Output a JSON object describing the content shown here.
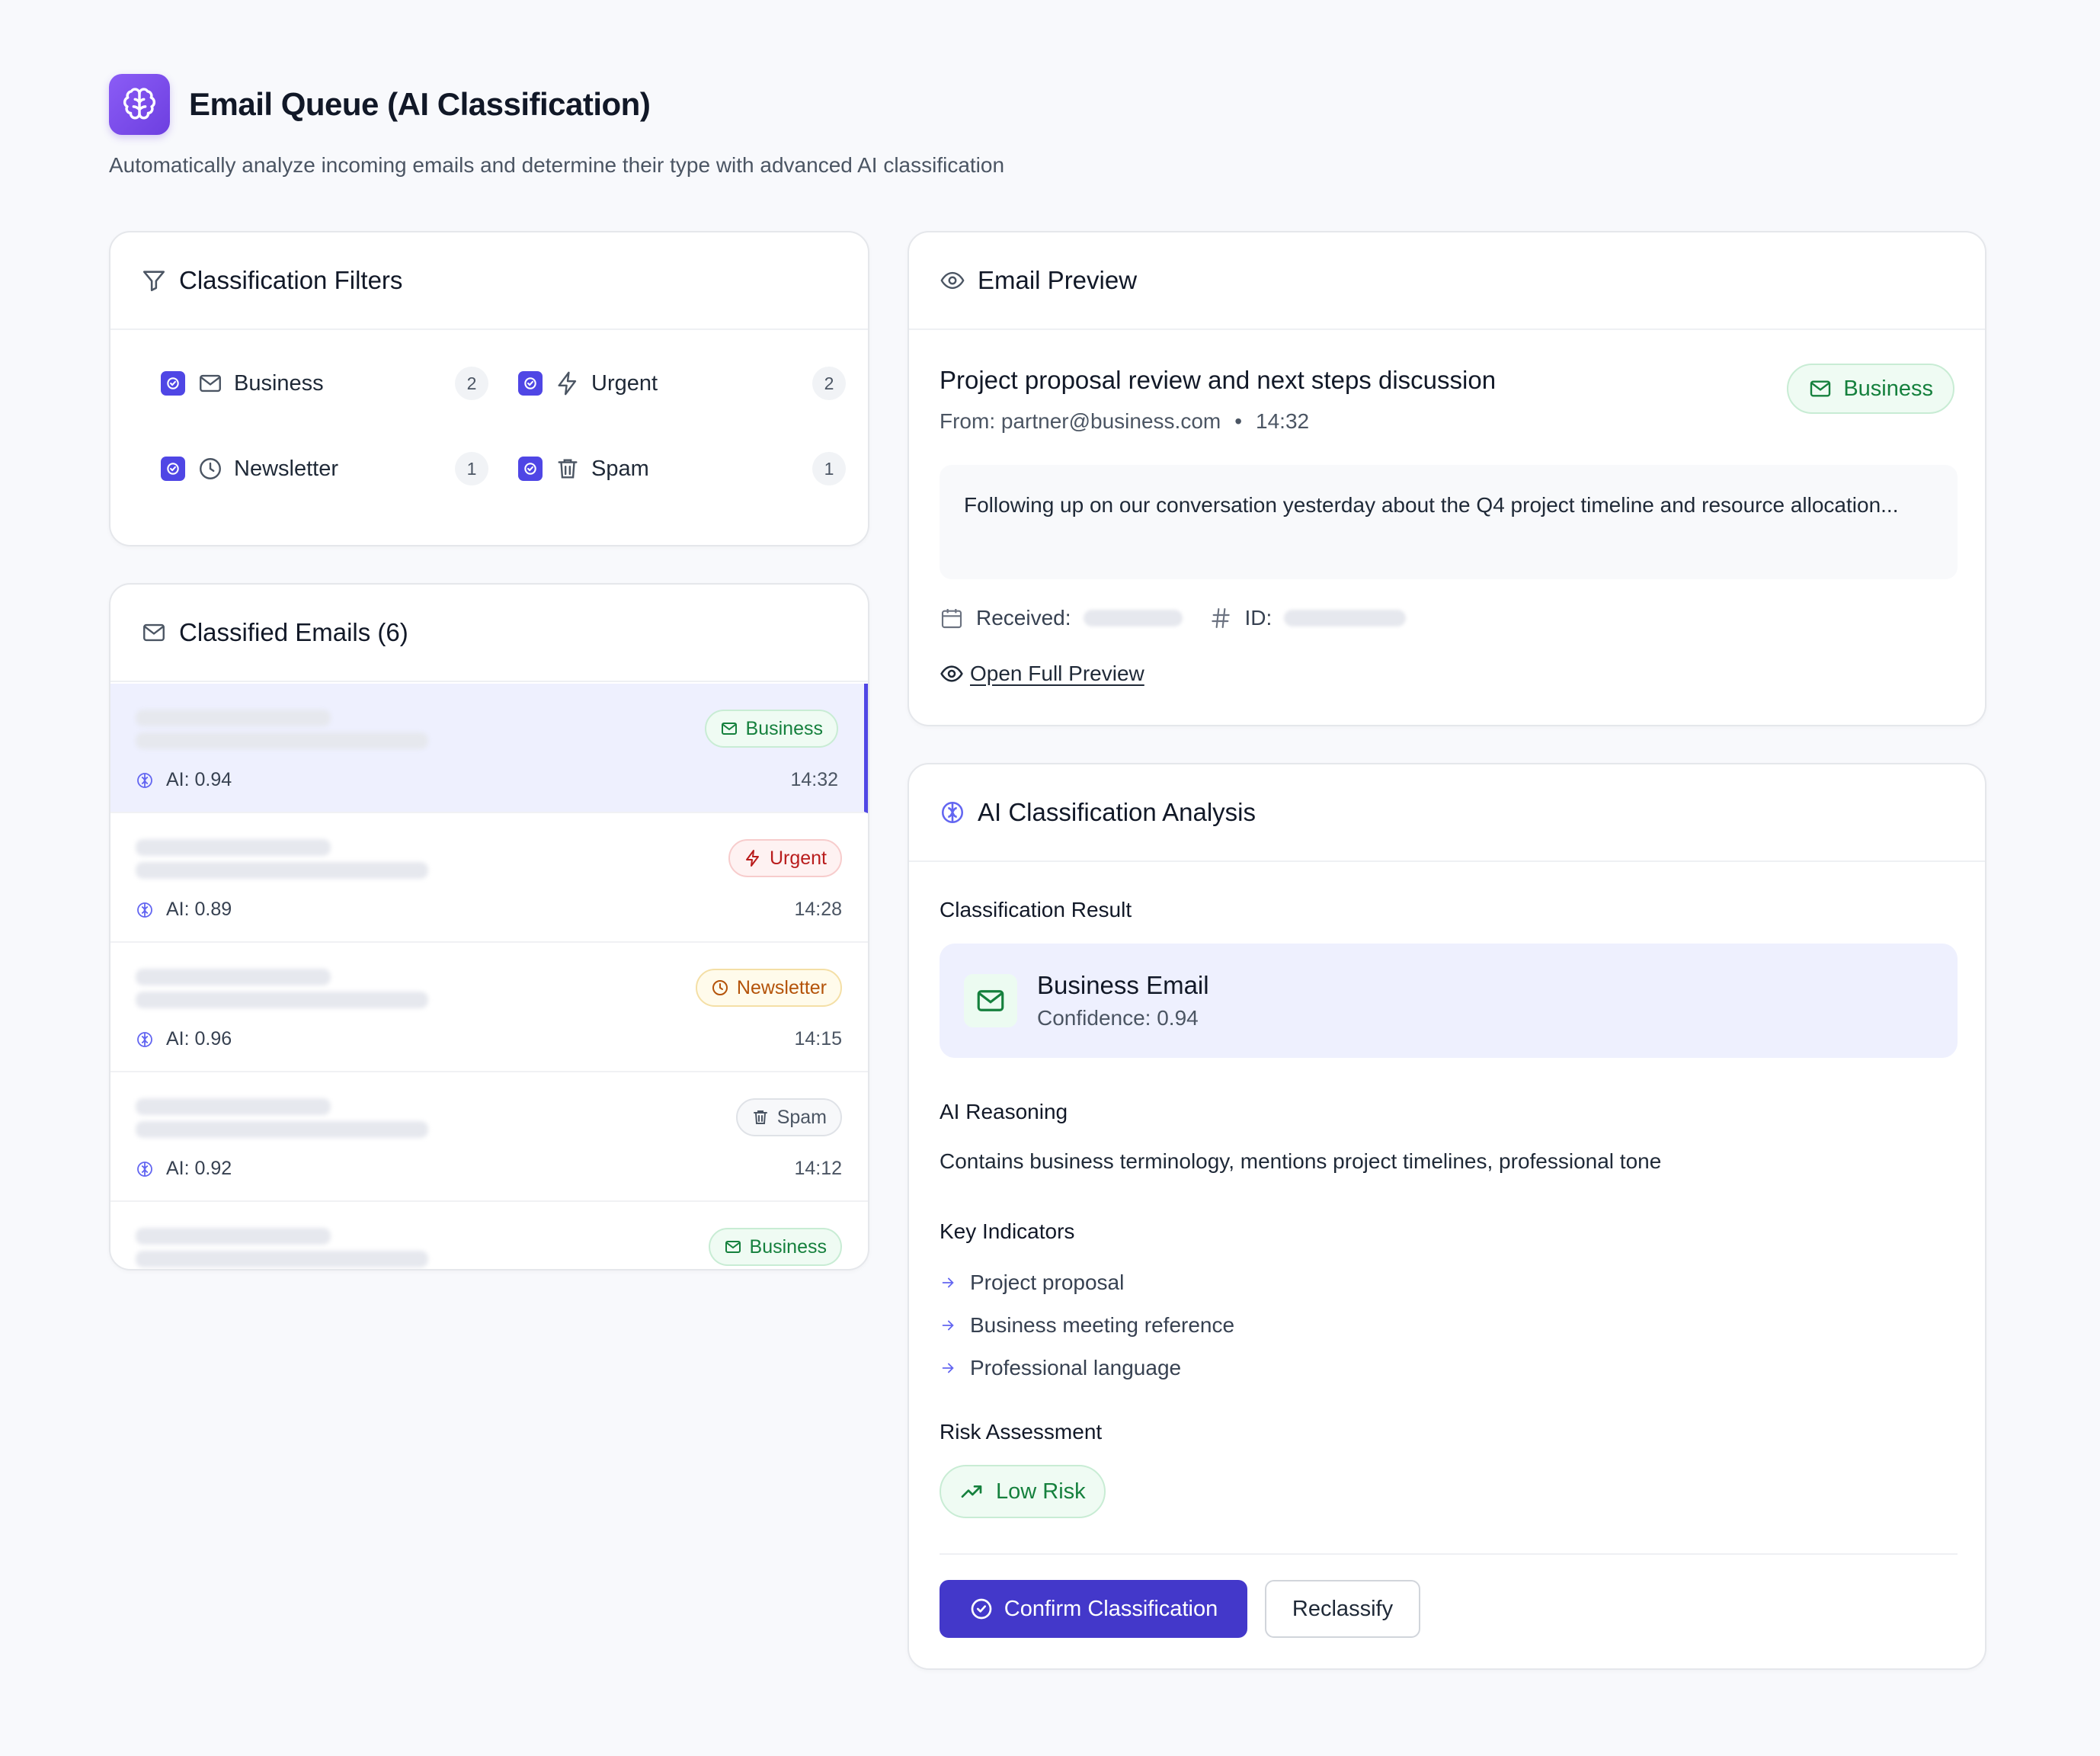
{
  "header": {
    "title": "Email Queue (AI Classification)",
    "subtitle": "Automatically analyze incoming emails and determine their type with advanced AI classification",
    "logo_icon": "brain-icon",
    "accent": "#7c4dff"
  },
  "filters": {
    "title": "Classification Filters",
    "items": [
      {
        "label": "Business",
        "count": "2",
        "icon": "mail-icon",
        "checked": true
      },
      {
        "label": "Urgent",
        "count": "2",
        "icon": "zap-icon",
        "checked": true
      },
      {
        "label": "Newsletter",
        "count": "1",
        "icon": "clock-icon",
        "checked": true
      },
      {
        "label": "Spam",
        "count": "1",
        "icon": "trash-icon",
        "checked": true
      }
    ]
  },
  "emails": {
    "title": "Classified Emails (6)",
    "items": [
      {
        "tag": "Business",
        "ai": "AI: 0.94",
        "time": "14:32",
        "selected": true
      },
      {
        "tag": "Urgent",
        "ai": "AI: 0.89",
        "time": "14:28"
      },
      {
        "tag": "Newsletter",
        "ai": "AI: 0.96",
        "time": "14:15"
      },
      {
        "tag": "Spam",
        "ai": "AI: 0.92",
        "time": "14:12"
      },
      {
        "tag": "Business"
      }
    ]
  },
  "preview": {
    "title": "Email Preview",
    "subject": "Project proposal review and next steps discussion",
    "from": "From: partner@business.com",
    "separator": "•",
    "time": "14:32",
    "badge": "Business",
    "body": "Following up on our conversation yesterday about the Q4 project timeline and resource allocation...",
    "received_label": "Received:",
    "id_label": "ID:",
    "open_label": "Open Full Preview"
  },
  "analysis": {
    "title": "AI Classification Analysis",
    "result_label": "Classification Result",
    "result_title": "Business Email",
    "result_confidence": "Confidence: 0.94",
    "reasoning_label": "AI Reasoning",
    "reasoning": "Contains business terminology, mentions project timelines, professional tone",
    "indicators_label": "Key Indicators",
    "indicators": [
      "Project proposal",
      "Business meeting reference",
      "Professional language"
    ],
    "risk_label": "Risk Assessment",
    "risk_value": "Low Risk",
    "confirm_label": "Confirm Classification",
    "reclassify_label": "Reclassify"
  },
  "colors": {
    "primary": "#4338ca",
    "business": "#15803d",
    "urgent": "#b91c1c",
    "newsletter": "#b45309",
    "spam": "#4b5563"
  }
}
